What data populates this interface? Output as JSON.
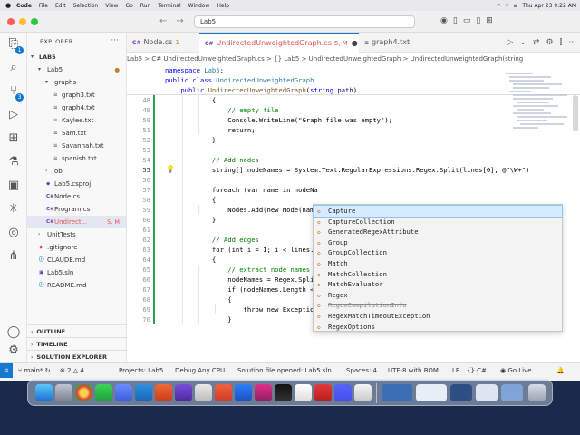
{
  "menubar": {
    "app": "Code",
    "items": [
      "File",
      "Edit",
      "Selection",
      "View",
      "Go",
      "Run",
      "Terminal",
      "Window",
      "Help"
    ],
    "clock": "Thu Apr 23  9:22 AM"
  },
  "titlebar": {
    "search_text": "Lab5"
  },
  "explorer": {
    "title": "EXPLORER",
    "root": "LAB5",
    "items": [
      {
        "label": "Lab5",
        "type": "folder",
        "depth": 1,
        "status": "●"
      },
      {
        "label": "graphs",
        "type": "folder",
        "depth": 2,
        "status": ""
      },
      {
        "label": "graph3.txt",
        "type": "file",
        "depth": 3,
        "status": ""
      },
      {
        "label": "graph4.txt",
        "type": "file",
        "depth": 3,
        "status": ""
      },
      {
        "label": "Kaylee.txt",
        "type": "file",
        "depth": 3,
        "status": ""
      },
      {
        "label": "Sam.txt",
        "type": "file",
        "depth": 3,
        "status": ""
      },
      {
        "label": "Savannah.txt",
        "type": "file",
        "depth": 3,
        "status": ""
      },
      {
        "label": "spanish.txt",
        "type": "file",
        "depth": 3,
        "status": ""
      },
      {
        "label": "obj",
        "type": "folder-closed",
        "depth": 2,
        "status": ""
      },
      {
        "label": "Lab5.csproj",
        "type": "csproj",
        "depth": 2,
        "status": ""
      },
      {
        "label": "Node.cs",
        "type": "cs",
        "depth": 2,
        "status": ""
      },
      {
        "label": "Program.cs",
        "type": "cs",
        "depth": 2,
        "status": ""
      },
      {
        "label": "Undirect...",
        "type": "cs",
        "depth": 2,
        "status": "5, M"
      },
      {
        "label": "UnitTests",
        "type": "folder-closed",
        "depth": 1,
        "status": ""
      },
      {
        "label": ".gitignore",
        "type": "git",
        "depth": 1,
        "status": ""
      },
      {
        "label": "CLAUDE.md",
        "type": "md",
        "depth": 1,
        "status": ""
      },
      {
        "label": "Lab5.sln",
        "type": "sln",
        "depth": 1,
        "status": ""
      },
      {
        "label": "README.md",
        "type": "md",
        "depth": 1,
        "status": ""
      }
    ],
    "sections": [
      "OUTLINE",
      "TIMELINE",
      "SOLUTION EXPLORER"
    ]
  },
  "tabs": [
    {
      "label": "Node.cs",
      "icon": "C#",
      "active": false,
      "mark": "1"
    },
    {
      "label": "UndirectedUnweightedGraph.cs",
      "icon": "C#",
      "active": true,
      "mark": "5, M"
    },
    {
      "label": "graph4.txt",
      "icon": "txt",
      "active": false,
      "mark": ""
    }
  ],
  "breadcrumb": "Lab5 > C# UndirectedUnweightedGraph.cs > {} Lab5 > UndirectedUnweightedGraph > UndirectedUnweightedGraph(string",
  "sticky": [
    {
      "num": "",
      "text": "namespace Lab5;"
    },
    {
      "num": "",
      "text": "public class UndirectedUnweightedGraph"
    },
    {
      "num": "",
      "text": "    public UndirectedUnweightedGraph(string path)"
    }
  ],
  "code_lines": [
    {
      "num": "48",
      "text": "            {"
    },
    {
      "num": "49",
      "text": "                // empty file"
    },
    {
      "num": "50",
      "text": "                Console.WriteLine(\"Graph file was empty\");"
    },
    {
      "num": "51",
      "text": "                return;"
    },
    {
      "num": "52",
      "text": "            }"
    },
    {
      "num": "53",
      "text": ""
    },
    {
      "num": "54",
      "text": "            // Add nodes"
    },
    {
      "num": "55",
      "text": "            string[] nodeNames = System.Text.RegularExpressions.Regex.Split(lines[0], @\"\\W+\")"
    },
    {
      "num": "56",
      "text": ""
    },
    {
      "num": "57",
      "text": "            foreach (var name in nodeNa"
    },
    {
      "num": "58",
      "text": "            {"
    },
    {
      "num": "59",
      "text": "                Nodes.Add(new Node(name"
    },
    {
      "num": "60",
      "text": "            }"
    },
    {
      "num": "61",
      "text": ""
    },
    {
      "num": "62",
      "text": "            // Add edges"
    },
    {
      "num": "63",
      "text": "            for (int i = 1; i < lines.Co"
    },
    {
      "num": "64",
      "text": "            {"
    },
    {
      "num": "65",
      "text": "                // extract node names"
    },
    {
      "num": "66",
      "text": "                nodeNames = Regex.Split"
    },
    {
      "num": "67",
      "text": "                if (nodeNames.Length < 2"
    },
    {
      "num": "68",
      "text": "                {"
    },
    {
      "num": "69",
      "text": "                    throw new Exception(\"Two nodes are required for each edge.\");"
    },
    {
      "num": "70",
      "text": "                }"
    }
  ],
  "suggestions": [
    {
      "label": "Capture",
      "selected": true,
      "strike": false
    },
    {
      "label": "CaptureCollection",
      "selected": false,
      "strike": false
    },
    {
      "label": "GeneratedRegexAttribute",
      "selected": false,
      "strike": false
    },
    {
      "label": "Group",
      "selected": false,
      "strike": false
    },
    {
      "label": "GroupCollection",
      "selected": false,
      "strike": false
    },
    {
      "label": "Match",
      "selected": false,
      "strike": false
    },
    {
      "label": "MatchCollection",
      "selected": false,
      "strike": false
    },
    {
      "label": "MatchEvaluator",
      "selected": false,
      "strike": false
    },
    {
      "label": "Regex",
      "selected": false,
      "strike": false
    },
    {
      "label": "RegexCompilationInfo",
      "selected": false,
      "strike": true
    },
    {
      "label": "RegexMatchTimeoutException",
      "selected": false,
      "strike": false
    },
    {
      "label": "RegexOptions",
      "selected": false,
      "strike": false
    }
  ],
  "statusbar": {
    "branch": "main*",
    "errors": "2",
    "warnings": "4",
    "projects": "Projects: Lab5",
    "config": "Debug Any CPU",
    "solution": "Solution file opened: Lab5.sln",
    "spaces": "Spaces: 4",
    "encoding": "UTF-8 with BOM",
    "eol": "LF",
    "language": "C#",
    "golive": "Go Live"
  },
  "colors": {
    "accent": "#1677cf",
    "modified": "#e05252",
    "warning": "#b8862b"
  }
}
